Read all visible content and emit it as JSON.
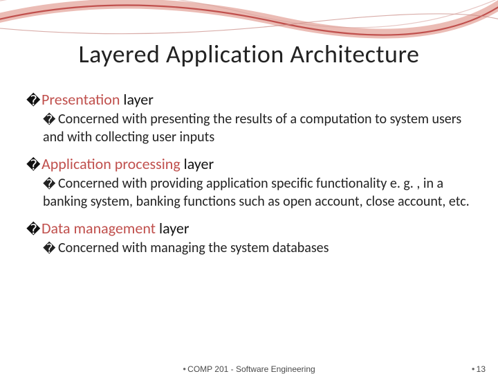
{
  "title": "Layered Application Architecture",
  "sections": {
    "s1": {
      "heading_pre": "Presentation",
      "heading_post": " layer",
      "body": "Concerned with presenting the results of a computation to system users and with collecting user inputs"
    },
    "s2": {
      "heading_pre": "Application processing",
      "heading_post": " layer",
      "body": "Concerned with providing application specific functionality e. g. , in a banking system, banking functions such as open account, close account, etc."
    },
    "s3": {
      "heading_pre": "Data management",
      "heading_post": " layer",
      "body": "Concerned with managing the system databases"
    }
  },
  "footer": {
    "center": "COMP 201 - Software Engineering",
    "page": "13"
  },
  "glyphs": {
    "bullet_l1": "�",
    "bullet_l2": "�",
    "dot": "●"
  }
}
